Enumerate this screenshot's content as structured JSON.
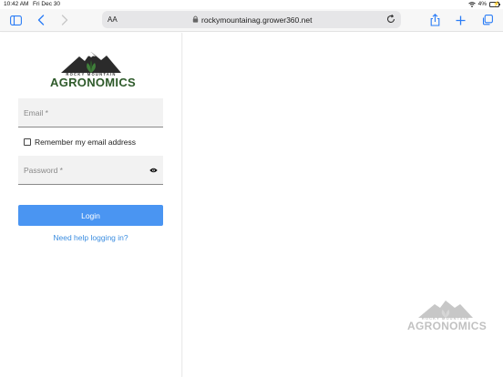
{
  "status_bar": {
    "time": "10:42 AM",
    "date": "Fri Dec 30",
    "battery": "4%"
  },
  "browser": {
    "text_size_label": "AA",
    "url": "rockymountainag.grower360.net",
    "icons": [
      "sidebar-icon",
      "back-icon",
      "forward-icon",
      "lock-icon",
      "reload-icon",
      "share-icon",
      "new-tab-icon",
      "tabs-icon"
    ]
  },
  "brand": {
    "name_small": "ROCKY MOUNTAIN",
    "name_big": "AGRONOMICS",
    "green": "#2e5a2a"
  },
  "login_form": {
    "email_placeholder": "Email *",
    "remember_label": "Remember my email address",
    "remember_checked": false,
    "password_placeholder": "Password *",
    "login_label": "Login",
    "help_link": "Need help logging in?",
    "button_color": "#4a95f2",
    "link_color": "#3b8de0"
  },
  "watermark": {
    "name_small": "ROCKY MOUNTAIN",
    "name_big": "AGRONOMICS"
  }
}
